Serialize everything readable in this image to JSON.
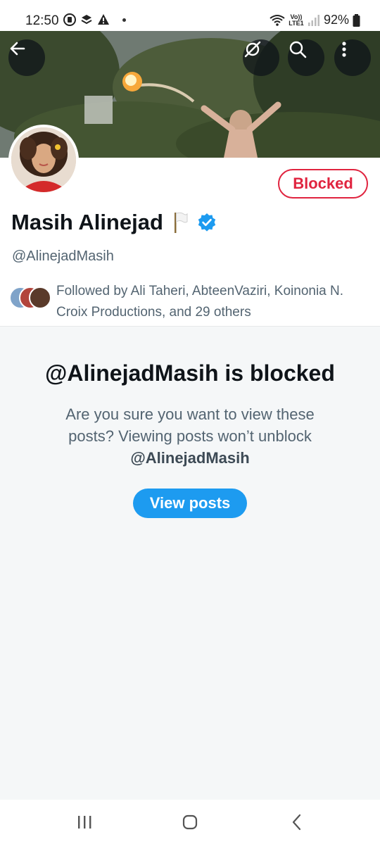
{
  "status_bar": {
    "time": "12:50",
    "network_label": "Vo)) LTE1",
    "battery": "92%"
  },
  "banner": {
    "icons": [
      "back-arrow-icon",
      "grok-icon",
      "search-icon",
      "more-icon"
    ]
  },
  "profile": {
    "display_name": "Masih Alinejad",
    "flag_emoji": "🏳️",
    "handle": "@AlinejadMasih",
    "blocked_label": "Blocked",
    "followed_by": "Followed by Ali Taheri, AbteenVaziri, Koinonia N. Croix Productions, and 29 others"
  },
  "blocked_panel": {
    "title": "@AlinejadMasih is blocked",
    "description": "Are you sure you want to view these posts? Viewing posts won’t unblock",
    "description_handle": "@AlinejadMasih",
    "button_label": "View posts"
  },
  "colors": {
    "accent": "#1d9bf0",
    "blocked": "#e0243f",
    "secondary_text": "#536471",
    "verified": "#1d9bf0"
  }
}
